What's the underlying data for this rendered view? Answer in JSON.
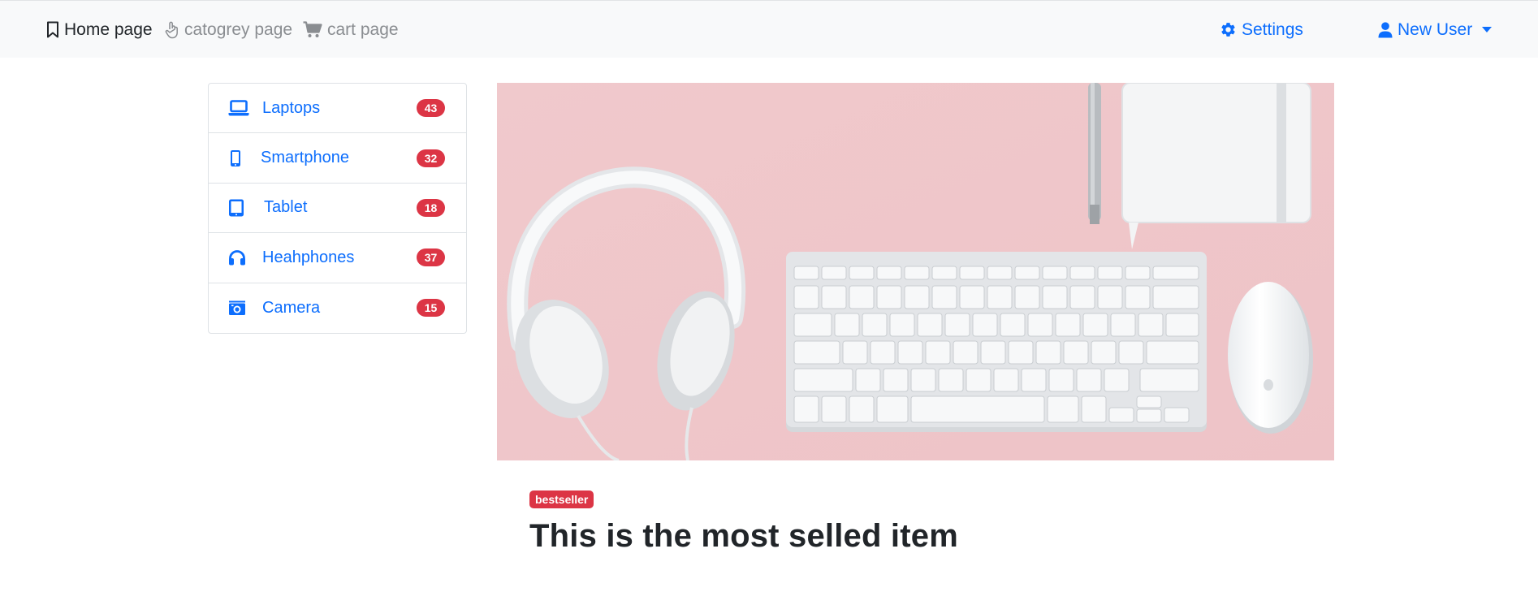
{
  "navbar": {
    "home_label": "Home page",
    "category_label": "catogrey page",
    "cart_label": "cart page",
    "settings_label": "Settings",
    "user_label": "New User"
  },
  "sidebar": {
    "items": [
      {
        "label": "Laptops",
        "count": "43",
        "icon": "laptop-icon"
      },
      {
        "label": "Smartphone",
        "count": "32",
        "icon": "smartphone-icon"
      },
      {
        "label": "Tablet",
        "count": "18",
        "icon": "tablet-icon"
      },
      {
        "label": "Heahphones",
        "count": "37",
        "icon": "headphones-icon"
      },
      {
        "label": "Camera",
        "count": "15",
        "icon": "camera-icon"
      }
    ]
  },
  "featured": {
    "badge": "bestseller",
    "title": "This is the most selled item"
  },
  "colors": {
    "primary": "#0d6efd",
    "danger": "#dc3545",
    "navbar_bg": "#f8f9fa",
    "hero_bg": "#efc7cb"
  }
}
